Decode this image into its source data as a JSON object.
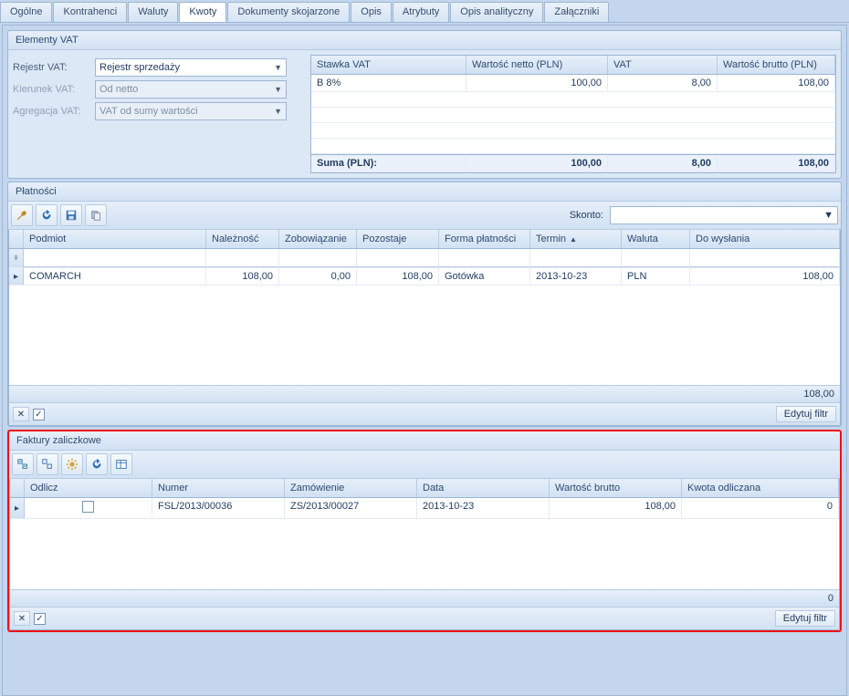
{
  "tabs": {
    "t0": "Ogólne",
    "t1": "Kontrahenci",
    "t2": "Waluty",
    "t3": "Kwoty",
    "t4": "Dokumenty skojarzone",
    "t5": "Opis",
    "t6": "Atrybuty",
    "t7": "Opis analityczny",
    "t8": "Załączniki",
    "active": "t3"
  },
  "vat": {
    "title": "Elementy VAT",
    "labels": {
      "register": "Rejestr VAT:",
      "direction": "Kierunek VAT:",
      "aggregation": "Agregacja VAT:"
    },
    "values": {
      "register": "Rejestr sprzedaży",
      "direction": "Od netto",
      "aggregation": "VAT od sumy wartości"
    },
    "grid": {
      "headers": {
        "rate": "Stawka VAT",
        "net": "Wartość netto (PLN)",
        "vat": "VAT",
        "gross": "Wartość brutto (PLN)"
      },
      "rows": [
        {
          "rate": "B 8%",
          "net": "100,00",
          "vat": "8,00",
          "gross": "108,00"
        }
      ],
      "sum": {
        "label": "Suma (PLN):",
        "net": "100,00",
        "vat": "8,00",
        "gross": "108,00"
      }
    }
  },
  "payments": {
    "title": "Płatności",
    "skontoLabel": "Skonto:",
    "headers": {
      "subject": "Podmiot",
      "due": "Należność",
      "liability": "Zobowiązanie",
      "remaining": "Pozostaje",
      "form": "Forma płatności",
      "term": "Termin",
      "currency": "Waluta",
      "tosend": "Do wysłania"
    },
    "rows": [
      {
        "subject": "COMARCH",
        "due": "108,00",
        "liability": "0,00",
        "remaining": "108,00",
        "form": "Gotówka",
        "term": "2013-10-23",
        "currency": "PLN",
        "tosend": "108,00"
      }
    ],
    "footer": "108,00",
    "editFilter": "Edytuj filtr"
  },
  "advance": {
    "title": "Faktury zaliczkowe",
    "headers": {
      "deduct": "Odlicz",
      "number": "Numer",
      "order": "Zamówienie",
      "date": "Data",
      "gross": "Wartość brutto",
      "deducted": "Kwota odliczana"
    },
    "rows": [
      {
        "deduct": false,
        "number": "FSL/2013/00036",
        "order": "ZS/2013/00027",
        "date": "2013-10-23",
        "gross": "108,00",
        "deducted": "0"
      }
    ],
    "footer": "0",
    "editFilter": "Edytuj filtr"
  }
}
